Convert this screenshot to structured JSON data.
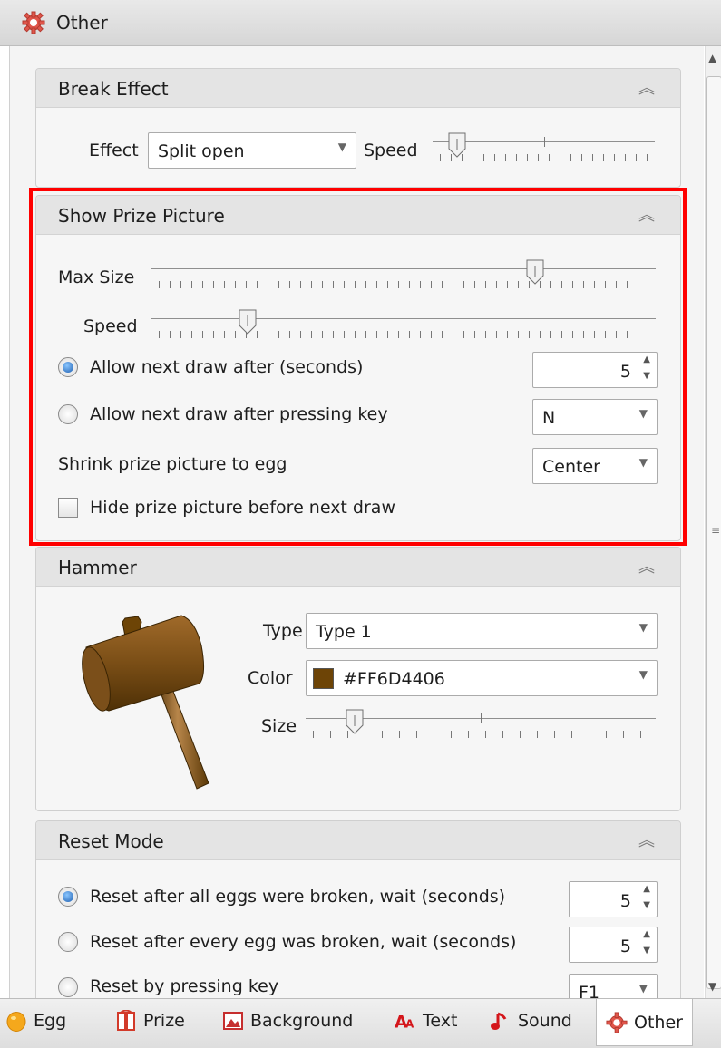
{
  "header": {
    "title": "Other",
    "icon": "gear-icon"
  },
  "break_effect": {
    "title": "Break Effect",
    "effect_label": "Effect",
    "effect_value": "Split open",
    "speed_label": "Speed",
    "speed_value": 0.11
  },
  "show_prize_picture": {
    "title": "Show Prize Picture",
    "max_size_label": "Max Size",
    "max_size_value": 0.76,
    "speed_label": "Speed",
    "speed_value": 0.19,
    "allow_after_seconds_label": "Allow next draw after (seconds)",
    "allow_after_seconds_value": "5",
    "allow_after_key_label": "Allow next draw after pressing key",
    "allow_after_key_value": "N",
    "shrink_label": "Shrink prize picture to egg",
    "shrink_value": "Center",
    "hide_label": "Hide prize picture before next draw",
    "hide_checked": false,
    "selected_mode": "seconds"
  },
  "hammer": {
    "title": "Hammer",
    "type_label": "Type",
    "type_value": "Type 1",
    "color_label": "Color",
    "color_value": "#FF6D4406",
    "color_hex": "#6D4406",
    "size_label": "Size",
    "size_value": 0.14
  },
  "reset_mode": {
    "title": "Reset Mode",
    "options": [
      {
        "label": "Reset after all eggs were broken, wait (seconds)",
        "value": "5",
        "selected": true
      },
      {
        "label": "Reset after every egg was broken, wait (seconds)",
        "value": "5",
        "selected": false
      },
      {
        "label": "Reset by pressing key",
        "value": "F1",
        "selected": false
      }
    ]
  },
  "tabs": [
    {
      "label": "Egg",
      "icon": "egg-icon"
    },
    {
      "label": "Prize",
      "icon": "prize-icon"
    },
    {
      "label": "Background",
      "icon": "background-icon"
    },
    {
      "label": "Text",
      "icon": "text-icon"
    },
    {
      "label": "Sound",
      "icon": "sound-icon"
    },
    {
      "label": "Other",
      "icon": "gear-icon",
      "active": true
    }
  ],
  "colors": {
    "highlight": "#FF0000",
    "radio_selected": "#1F5FB0"
  }
}
